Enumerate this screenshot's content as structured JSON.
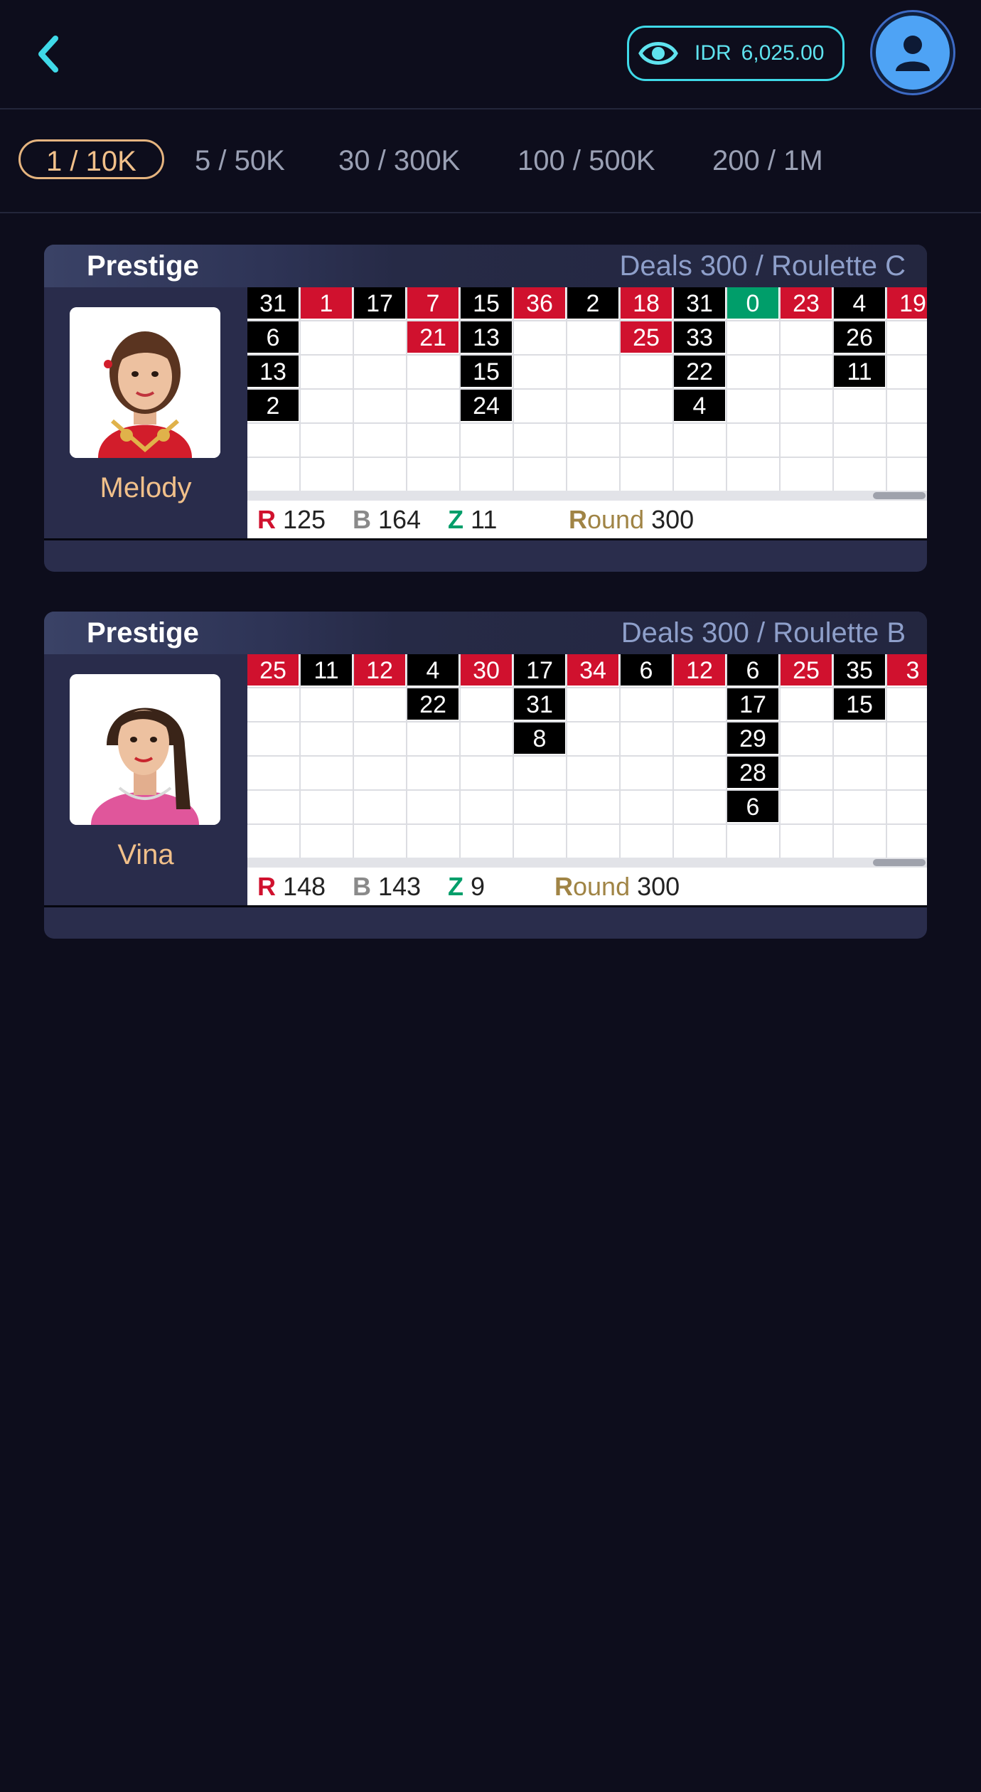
{
  "header": {
    "balance_currency": "IDR",
    "balance_amount": "6,025.00",
    "accent_color": "#3fd9e8"
  },
  "tabs": [
    {
      "label": "1 / 10K",
      "active": true
    },
    {
      "label": "5 / 50K"
    },
    {
      "label": "30 / 300K"
    },
    {
      "label": "100 / 500K"
    },
    {
      "label": "200 / 1M"
    }
  ],
  "tables": [
    {
      "title": "Prestige",
      "deals": "Deals 300 / Roulette C",
      "dealer": "Melody",
      "columns": [
        [
          {
            "n": "31",
            "c": "black"
          },
          {
            "n": "6",
            "c": "black"
          },
          {
            "n": "13",
            "c": "black"
          },
          {
            "n": "2",
            "c": "black"
          }
        ],
        [
          {
            "n": "1",
            "c": "red"
          }
        ],
        [
          {
            "n": "17",
            "c": "black"
          }
        ],
        [
          {
            "n": "7",
            "c": "red"
          },
          {
            "n": "21",
            "c": "red"
          }
        ],
        [
          {
            "n": "15",
            "c": "black"
          },
          {
            "n": "13",
            "c": "black"
          },
          {
            "n": "15",
            "c": "black"
          },
          {
            "n": "24",
            "c": "black"
          }
        ],
        [
          {
            "n": "36",
            "c": "red"
          }
        ],
        [
          {
            "n": "2",
            "c": "black"
          }
        ],
        [
          {
            "n": "18",
            "c": "red"
          },
          {
            "n": "25",
            "c": "red"
          }
        ],
        [
          {
            "n": "31",
            "c": "black"
          },
          {
            "n": "33",
            "c": "black"
          },
          {
            "n": "22",
            "c": "black"
          },
          {
            "n": "4",
            "c": "black"
          }
        ],
        [
          {
            "n": "0",
            "c": "green"
          }
        ],
        [
          {
            "n": "23",
            "c": "red"
          }
        ],
        [
          {
            "n": "4",
            "c": "black"
          },
          {
            "n": "26",
            "c": "black"
          },
          {
            "n": "11",
            "c": "black"
          }
        ],
        [
          {
            "n": "19",
            "c": "red"
          }
        ]
      ],
      "stats": {
        "r_label": "R",
        "r": "125",
        "b_label": "B",
        "b": "164",
        "z_label": "Z",
        "z": "11",
        "round_first": "R",
        "round_rest": "ound",
        "round": "300"
      }
    },
    {
      "title": "Prestige",
      "deals": "Deals 300 / Roulette B",
      "dealer": "Vina",
      "columns": [
        [
          {
            "n": "25",
            "c": "red"
          }
        ],
        [
          {
            "n": "11",
            "c": "black"
          }
        ],
        [
          {
            "n": "12",
            "c": "red"
          }
        ],
        [
          {
            "n": "4",
            "c": "black"
          },
          {
            "n": "22",
            "c": "black"
          }
        ],
        [
          {
            "n": "30",
            "c": "red"
          }
        ],
        [
          {
            "n": "17",
            "c": "black"
          },
          {
            "n": "31",
            "c": "black"
          },
          {
            "n": "8",
            "c": "black"
          }
        ],
        [
          {
            "n": "34",
            "c": "red"
          }
        ],
        [
          {
            "n": "6",
            "c": "black"
          }
        ],
        [
          {
            "n": "12",
            "c": "red"
          }
        ],
        [
          {
            "n": "6",
            "c": "black"
          },
          {
            "n": "17",
            "c": "black"
          },
          {
            "n": "29",
            "c": "black"
          },
          {
            "n": "28",
            "c": "black"
          },
          {
            "n": "6",
            "c": "black"
          }
        ],
        [
          {
            "n": "25",
            "c": "red"
          }
        ],
        [
          {
            "n": "35",
            "c": "black"
          },
          {
            "n": "15",
            "c": "black"
          }
        ],
        [
          {
            "n": "3",
            "c": "red"
          }
        ]
      ],
      "stats": {
        "r_label": "R",
        "r": "148",
        "b_label": "B",
        "b": "143",
        "z_label": "Z",
        "z": "9",
        "round_first": "R",
        "round_rest": "ound",
        "round": "300"
      }
    }
  ]
}
